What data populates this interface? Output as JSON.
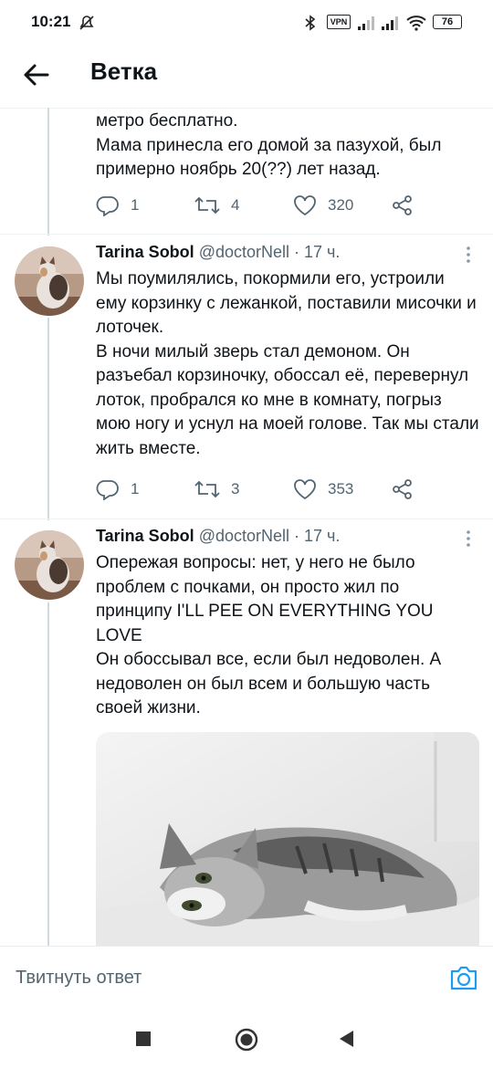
{
  "status_bar": {
    "time": "10:21",
    "battery": "76",
    "vpn_label": "VPN"
  },
  "header": {
    "title": "Ветка"
  },
  "tweets": [
    {
      "text": "метро бесплатно.\nМама принесла его домой за пазухой, был примерно ноябрь 20(??) лет назад.",
      "replies": "1",
      "retweets": "4",
      "likes": "320"
    },
    {
      "author": "Tarina Sobol",
      "handle": "@doctorNell",
      "time": "· 17 ч.",
      "text": "Мы поумилялись, покормили его, устроили ему корзинку с лежанкой, поставили мисочки и лоточек.\nВ ночи милый зверь стал демоном. Он разъебал корзиночку, обоссал её, перевернул лоток, пробрался ко мне в комнату, погрыз мою ногу и уснул на моей голове. Так мы стали жить вместе.",
      "replies": "1",
      "retweets": "3",
      "likes": "353"
    },
    {
      "author": "Tarina Sobol",
      "handle": "@doctorNell",
      "time": "· 17 ч.",
      "text": "Опережая вопросы: нет, у него не было проблем с почками, он просто жил по принципу I'LL PEE ON EVERYTHING YOU LOVE\nОн обоссывал все, если был недоволен. А недоволен он был всем и большую часть своей жизни."
    }
  ],
  "reply_bar": {
    "label": "Твитнуть ответ"
  },
  "colors": {
    "text": "#0f1419",
    "secondary": "#536471",
    "accent": "#1d9bf0",
    "line": "#cfd9de"
  }
}
